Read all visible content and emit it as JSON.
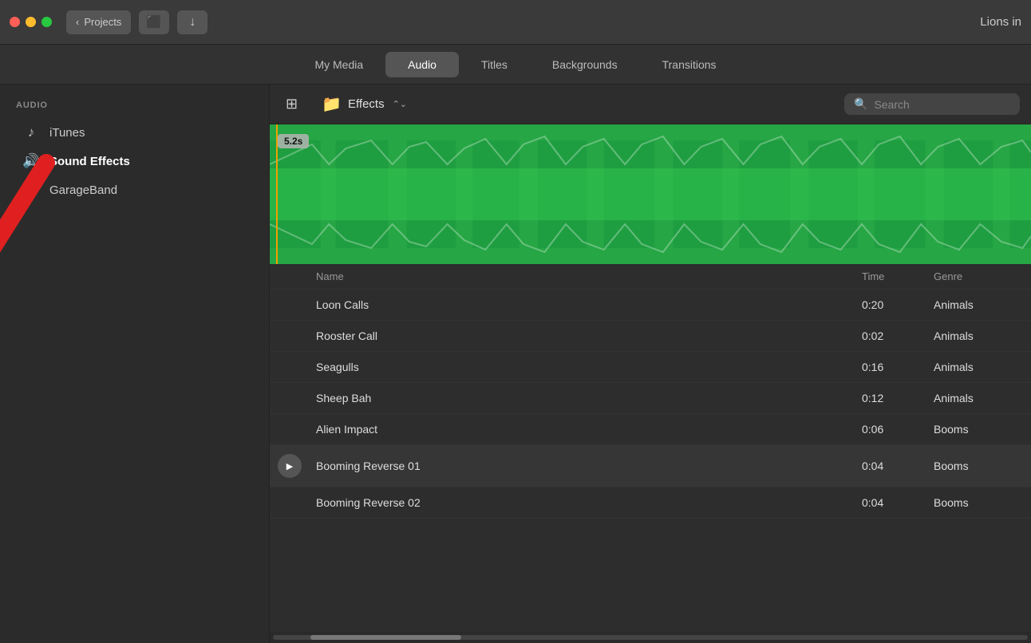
{
  "titlebar": {
    "projects_label": "Projects",
    "title_right": "Lions in",
    "download_icon": "↓",
    "filmstrip_icon": "🎬"
  },
  "nav": {
    "tabs": [
      {
        "id": "my-media",
        "label": "My Media"
      },
      {
        "id": "audio",
        "label": "Audio",
        "active": true
      },
      {
        "id": "titles",
        "label": "Titles"
      },
      {
        "id": "backgrounds",
        "label": "Backgrounds"
      },
      {
        "id": "transitions",
        "label": "Transitions"
      }
    ]
  },
  "sidebar": {
    "section_label": "AUDIO",
    "items": [
      {
        "id": "itunes",
        "label": "iTunes",
        "icon": "♪"
      },
      {
        "id": "sound-effects",
        "label": "Sound Effects",
        "icon": "🔊",
        "active": true
      },
      {
        "id": "garageband",
        "label": "GarageBand",
        "icon": "🎸"
      }
    ]
  },
  "content_toolbar": {
    "folder_icon": "📁",
    "folder_label": "Effects",
    "search_placeholder": "Search",
    "grid_icon": "⊞"
  },
  "waveform": {
    "time_badge": "5.2s"
  },
  "table": {
    "headers": [
      {
        "id": "play",
        "label": ""
      },
      {
        "id": "name",
        "label": "Name"
      },
      {
        "id": "time",
        "label": "Time"
      },
      {
        "id": "genre",
        "label": "Genre"
      }
    ],
    "rows": [
      {
        "name": "Loon Calls",
        "time": "0:20",
        "genre": "Animals",
        "playing": false,
        "has_play": false
      },
      {
        "name": "Rooster Call",
        "time": "0:02",
        "genre": "Animals",
        "playing": false,
        "has_play": false
      },
      {
        "name": "Seagulls",
        "time": "0:16",
        "genre": "Animals",
        "playing": false,
        "has_play": false
      },
      {
        "name": "Sheep Bah",
        "time": "0:12",
        "genre": "Animals",
        "playing": false,
        "has_play": false
      },
      {
        "name": "Alien Impact",
        "time": "0:06",
        "genre": "Booms",
        "playing": false,
        "has_play": false
      },
      {
        "name": "Booming Reverse 01",
        "time": "0:04",
        "genre": "Booms",
        "playing": true,
        "has_play": true
      },
      {
        "name": "Booming Reverse 02",
        "time": "0:04",
        "genre": "Booms",
        "playing": false,
        "has_play": false
      }
    ]
  }
}
